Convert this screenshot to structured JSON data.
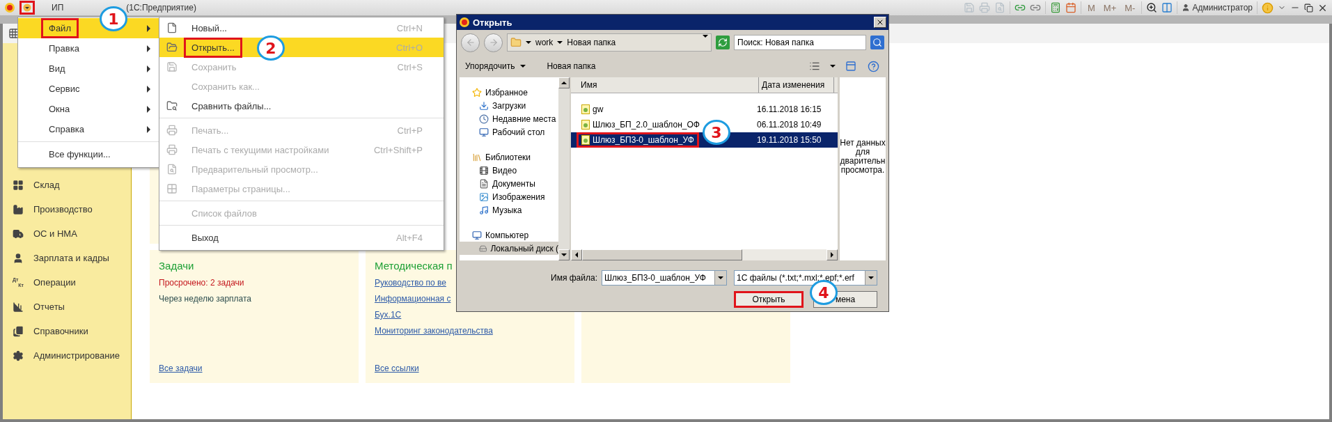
{
  "title_bar": {
    "menu_highlighted": true,
    "app": "ИП",
    "product": "(1С:Предприятие)",
    "memory_buttons": [
      "M",
      "M+",
      "M-"
    ],
    "user": "Администратор"
  },
  "sidebar": {
    "items": [
      {
        "label": "Склад"
      },
      {
        "label": "Производство"
      },
      {
        "label": "ОС и НМА"
      },
      {
        "label": "Зарплата и кадры"
      },
      {
        "label": "Операции",
        "icon_label": [
          "Дт",
          "Кт"
        ]
      },
      {
        "label": "Отчеты"
      },
      {
        "label": "Справочники"
      },
      {
        "label": "Администрирование"
      }
    ]
  },
  "cards": [
    {
      "title": "Задачи",
      "lines": [
        {
          "kind": "alert",
          "text": "Просрочено: 2 задачи"
        },
        {
          "kind": "note",
          "text": "Через неделю зарплата"
        }
      ],
      "footer_link": "Все задачи"
    },
    {
      "title": "Методическая п",
      "lines": [
        {
          "kind": "link",
          "text": "Руководство по ве"
        },
        {
          "kind": "link",
          "text": "Информационная с"
        },
        {
          "kind": "link",
          "text": "Бух.1С"
        },
        {
          "kind": "link",
          "text": "Мониторинг законодательства"
        }
      ],
      "footer_link": "Все ссылки"
    }
  ],
  "main_menu": {
    "items": [
      {
        "kind": "item",
        "label": "Файл",
        "submenu": true,
        "selected": true,
        "highlighted": true
      },
      {
        "kind": "item",
        "label": "Правка",
        "submenu": true,
        "selected": false,
        "highlighted": false
      },
      {
        "kind": "item",
        "label": "Вид",
        "submenu": true,
        "selected": false,
        "highlighted": false
      },
      {
        "kind": "item",
        "label": "Сервис",
        "submenu": true,
        "selected": false,
        "highlighted": false
      },
      {
        "kind": "item",
        "label": "Окна",
        "submenu": true,
        "selected": false,
        "highlighted": false
      },
      {
        "kind": "item",
        "label": "Справка",
        "submenu": true,
        "selected": false,
        "highlighted": false
      },
      {
        "kind": "separator"
      },
      {
        "kind": "item",
        "label": "Все функции...",
        "submenu": false,
        "selected": false,
        "highlighted": false
      }
    ]
  },
  "file_menu": {
    "items": [
      {
        "kind": "item",
        "label": "Новый...",
        "shortcut": "Ctrl+N",
        "disabled": false,
        "selected": false,
        "highlighted": false
      },
      {
        "kind": "item",
        "label": "Открыть...",
        "shortcut": "Ctrl+O",
        "disabled": false,
        "selected": true,
        "highlighted": true
      },
      {
        "kind": "item",
        "label": "Сохранить",
        "shortcut": "Ctrl+S",
        "disabled": true,
        "selected": false,
        "highlighted": false
      },
      {
        "kind": "item",
        "label": "Сохранить как...",
        "disabled": true,
        "selected": false,
        "highlighted": false
      },
      {
        "kind": "item",
        "label": "Сравнить файлы...",
        "disabled": false,
        "selected": false,
        "highlighted": false
      },
      {
        "kind": "separator"
      },
      {
        "kind": "item",
        "label": "Печать...",
        "shortcut": "Ctrl+P",
        "disabled": true,
        "selected": false,
        "highlighted": false
      },
      {
        "kind": "item",
        "label": "Печать с текущими настройками",
        "shortcut": "Ctrl+Shift+P",
        "disabled": true,
        "selected": false,
        "highlighted": false
      },
      {
        "kind": "item",
        "label": "Предварительный просмотр...",
        "disabled": true,
        "selected": false,
        "highlighted": false
      },
      {
        "kind": "item",
        "label": "Параметры страницы...",
        "disabled": true,
        "selected": false,
        "highlighted": false
      },
      {
        "kind": "separator"
      },
      {
        "kind": "item",
        "label": "Список файлов",
        "disabled": true,
        "selected": false,
        "highlighted": false
      },
      {
        "kind": "separator"
      },
      {
        "kind": "item",
        "label": "Выход",
        "shortcut": "Alt+F4",
        "disabled": false,
        "selected": false,
        "highlighted": false
      }
    ]
  },
  "dialog": {
    "title": "Открыть",
    "path": [
      "work",
      "Новая папка"
    ],
    "search_placeholder": "Поиск: Новая папка",
    "toolbar": [
      "Упорядочить",
      "Новая папка"
    ],
    "nav": [
      {
        "label": "Избранное",
        "selected": false,
        "children": [
          {
            "label": "Загрузки",
            "selected": false
          },
          {
            "label": "Недавние места",
            "selected": false
          },
          {
            "label": "Рабочий стол",
            "selected": false
          }
        ]
      },
      {
        "label": "Библиотеки",
        "selected": false,
        "children": [
          {
            "label": "Видео",
            "selected": false
          },
          {
            "label": "Документы",
            "selected": false
          },
          {
            "label": "Изображения",
            "selected": false
          },
          {
            "label": "Музыка",
            "selected": false
          }
        ]
      },
      {
        "label": "Компьютер",
        "selected": false,
        "children": [
          {
            "label": "Локальный диск (",
            "selected": true
          }
        ]
      }
    ],
    "columns": [
      "Имя",
      "Дата изменения"
    ],
    "files": [
      {
        "name": "gw",
        "date": "16.11.2018 16:15",
        "selected": false,
        "highlighted": false
      },
      {
        "name": "Шлюз_БП_2.0_шаблон_ОФ",
        "date": "06.11.2018 10:49",
        "selected": false,
        "highlighted": false
      },
      {
        "name": "Шлюз_БП3-0_шаблон_УФ",
        "date": "19.11.2018 15:50",
        "selected": true,
        "highlighted": true
      }
    ],
    "preview_lines": [
      "Нет данных",
      "для",
      "дварительн",
      "просмотра."
    ],
    "filename_label": "Имя файла:",
    "filename": "Шлюз_БП3-0_шаблон_УФ",
    "filter": "1С файлы (*.txt;*.mxl;*.epf;*.erf",
    "buttons": [
      {
        "label": "Открыть",
        "highlighted": true
      },
      {
        "label": "мена",
        "highlighted": false
      }
    ]
  },
  "annotations": [
    {
      "label": "1"
    },
    {
      "label": "2"
    },
    {
      "label": "3"
    },
    {
      "label": "4"
    }
  ]
}
